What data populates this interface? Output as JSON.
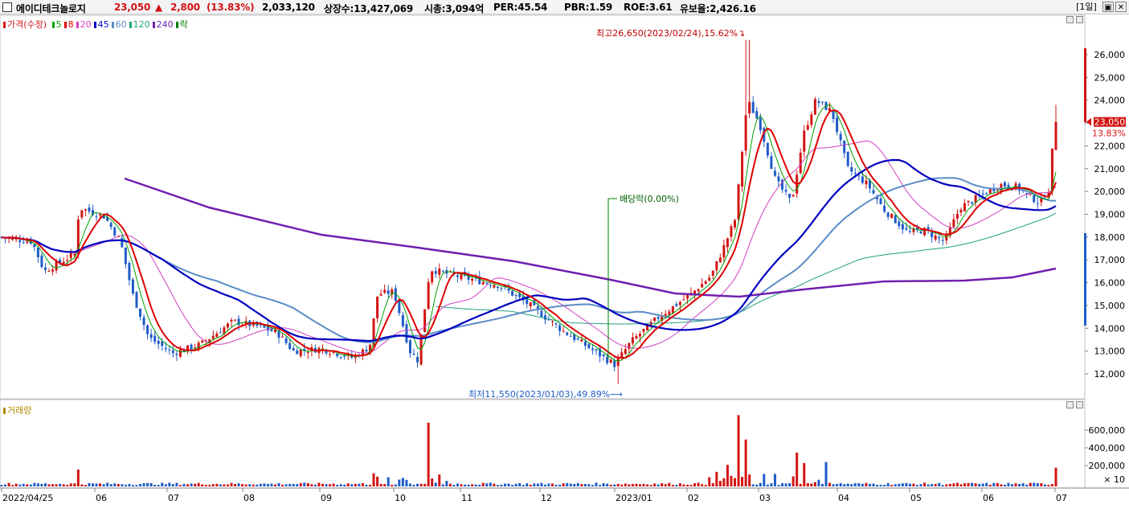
{
  "header": {
    "stock_name": "에이디테크놀로지",
    "price": "23,050",
    "change_arrow": "▲",
    "change": "2,800",
    "change_pct": "(13.83%)",
    "volume": "2,033,120",
    "listed_shares": "상장수:13,427,069",
    "market_cap": "시총:3,094억",
    "per": "PER:45.54",
    "pbr": "PBR:1.59",
    "roe": "ROE:3.61",
    "float": "유보율:2,426.16",
    "period_button": "[1일]",
    "restore_icon": "▣",
    "close_icon": "✕"
  },
  "legend": {
    "price_label": "가격(수정)",
    "items": [
      {
        "label": "5",
        "color": "#00a000"
      },
      {
        "label": "8",
        "color": "#e00000"
      },
      {
        "label": "20",
        "color": "#d040c0"
      },
      {
        "label": "45",
        "color": "#0000c0"
      },
      {
        "label": "60",
        "color": "#5a8cc8"
      },
      {
        "label": "120",
        "color": "#20a080"
      },
      {
        "label": "240",
        "color": "#7020b0"
      },
      {
        "label": "락",
        "color": "#008000"
      }
    ]
  },
  "annotations": {
    "high": "최고26,650(2023/02/24),15.62%",
    "low": "최저11,550(2023/01/03),49.89%",
    "dividend": "배당락(0.00%)"
  },
  "price_axis": {
    "ticks": [
      "26,000",
      "25,000",
      "24,000",
      "23,000",
      "22,000",
      "21,000",
      "20,000",
      "19,000",
      "18,000",
      "17,000",
      "16,000",
      "15,000",
      "14,000",
      "13,000",
      "12,000"
    ],
    "current_price": "23,050",
    "current_pct": "13.83%"
  },
  "volume_panel": {
    "label": "거래량",
    "ticks": [
      "600,000",
      "400,000",
      "200,000"
    ],
    "unit": "× 10"
  },
  "x_axis": {
    "labels": [
      "2022/04/25",
      "06",
      "07",
      "08",
      "09",
      "10",
      "11",
      "12",
      "2023/01",
      "02",
      "03",
      "04",
      "05",
      "06",
      "07"
    ]
  },
  "colors": {
    "up": "#d21414",
    "down": "#1f5cc8",
    "ma5": "#00a000",
    "ma8": "#e00000",
    "ma20": "#d040c0",
    "ma45": "#0000c0",
    "ma60": "#5a8cc8",
    "ma120": "#20a080",
    "ma240": "#7020b0"
  },
  "chart_data": {
    "type": "candlestick",
    "y_range": [
      11300,
      27000
    ],
    "x_labels": [
      "2022/04/25",
      "06",
      "07",
      "08",
      "09",
      "10",
      "11",
      "12",
      "2023/01",
      "02",
      "03",
      "04",
      "05",
      "06",
      "07"
    ],
    "key_points": [
      {
        "date": "2022-04-25",
        "close": 18000
      },
      {
        "date": "2022-05-25",
        "close": 19300
      },
      {
        "date": "2022-06-20",
        "close": 14500
      },
      {
        "date": "2022-07-05",
        "close": 12900
      },
      {
        "date": "2022-08-10",
        "close": 14000
      },
      {
        "date": "2022-09-20",
        "close": 12700
      },
      {
        "date": "2022-10-20",
        "close": 17200
      },
      {
        "date": "2022-11-15",
        "close": 16000
      },
      {
        "date": "2022-12-20",
        "close": 12800
      },
      {
        "date": "2023-01-03",
        "low": 11550
      },
      {
        "date": "2023-02-10",
        "close": 16300
      },
      {
        "date": "2023-02-24",
        "high": 26650
      },
      {
        "date": "2023-03-10",
        "close": 19400
      },
      {
        "date": "2023-03-28",
        "close": 25000
      },
      {
        "date": "2023-04-20",
        "close": 20000
      },
      {
        "date": "2023-05-22",
        "close": 17500
      },
      {
        "date": "2023-06-15",
        "close": 20500
      },
      {
        "date": "2023-06-30",
        "close": 19200
      },
      {
        "date": "2023-07-03",
        "close": 23050
      }
    ],
    "volume_y_range": [
      0,
      800000
    ]
  }
}
